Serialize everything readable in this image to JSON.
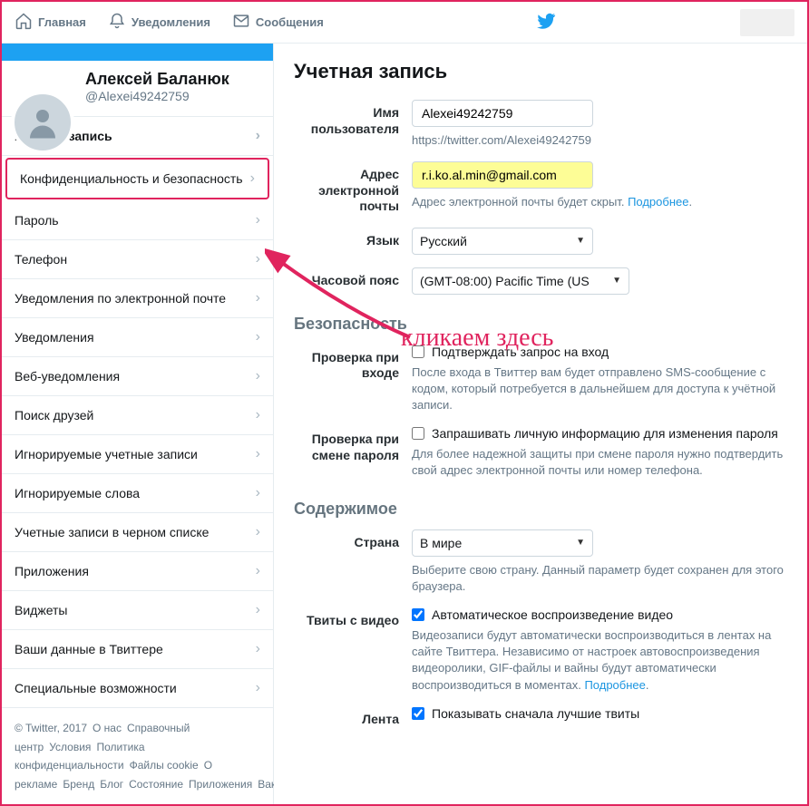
{
  "nav": {
    "home": "Главная",
    "notifications": "Уведомления",
    "messages": "Сообщения"
  },
  "profile": {
    "display_name": "Алексей Баланюк",
    "username": "@Alexei49242759"
  },
  "menu": [
    {
      "label": "Учетная запись",
      "strong": true
    },
    {
      "label": "Конфиденциальность и безопасность",
      "highlight": true
    },
    {
      "label": "Пароль"
    },
    {
      "label": "Телефон"
    },
    {
      "label": "Уведомления по электронной почте"
    },
    {
      "label": "Уведомления"
    },
    {
      "label": "Веб-уведомления"
    },
    {
      "label": "Поиск друзей"
    },
    {
      "label": "Игнорируемые учетные записи"
    },
    {
      "label": "Игнорируемые слова"
    },
    {
      "label": "Учетные записи в черном списке"
    },
    {
      "label": "Приложения"
    },
    {
      "label": "Виджеты"
    },
    {
      "label": "Ваши данные в Твиттере"
    },
    {
      "label": "Специальные возможности"
    }
  ],
  "footer": {
    "copyright": "© Twitter, 2017",
    "links": [
      "О нас",
      "Справочный центр",
      "Условия",
      "Политика конфиденциальности",
      "Файлы cookie",
      "О рекламе",
      "Бренд",
      "Блог",
      "Состояние",
      "Приложения",
      "Вакансии"
    ]
  },
  "account": {
    "title": "Учетная запись",
    "labels": {
      "username": "Имя пользователя",
      "email": "Адрес электронной почты",
      "language": "Язык",
      "timezone": "Часовой пояс"
    },
    "username_value": "Alexei49242759",
    "username_url": "https://twitter.com/Alexei49242759",
    "email_value": "r.i.ko.al.min@gmail.com",
    "email_hint": "Адрес электронной почты будет скрыт.",
    "learn_more": "Подробнее",
    "language_value": "Русский",
    "timezone_value": "(GMT-08:00) Pacific Time (US"
  },
  "security": {
    "title": "Безопасность",
    "login_verify": {
      "label": "Проверка при входе",
      "checkbox": "Подтверждать запрос на вход",
      "hint": "После входа в Твиттер вам будет отправлено SMS-сообщение с кодом, который потребуется в дальнейшем для доступа к учётной записи."
    },
    "pw_change": {
      "label": "Проверка при смене пароля",
      "checkbox": "Запрашивать личную информацию для изменения пароля",
      "hint": "Для более надежной защиты при смене пароля нужно подтвердить свой адрес электронной почты или номер телефона."
    }
  },
  "content": {
    "title": "Содержимое",
    "country": {
      "label": "Страна",
      "value": "В мире",
      "hint": "Выберите свою страну. Данный параметр будет сохранен для этого браузера."
    },
    "video": {
      "label": "Твиты с видео",
      "checkbox": "Автоматическое воспроизведение видео",
      "hint": "Видеозаписи будут автоматически воспроизводиться в лентах на сайте Твиттера. Независимо от настроек автовоспроизведения видеоролики, GIF-файлы и вайны будут автоматически воспроизводиться в моментах."
    },
    "feed": {
      "label": "Лента",
      "checkbox": "Показывать сначала лучшие твиты"
    }
  },
  "annotation": {
    "text": "кликаем здесь"
  }
}
